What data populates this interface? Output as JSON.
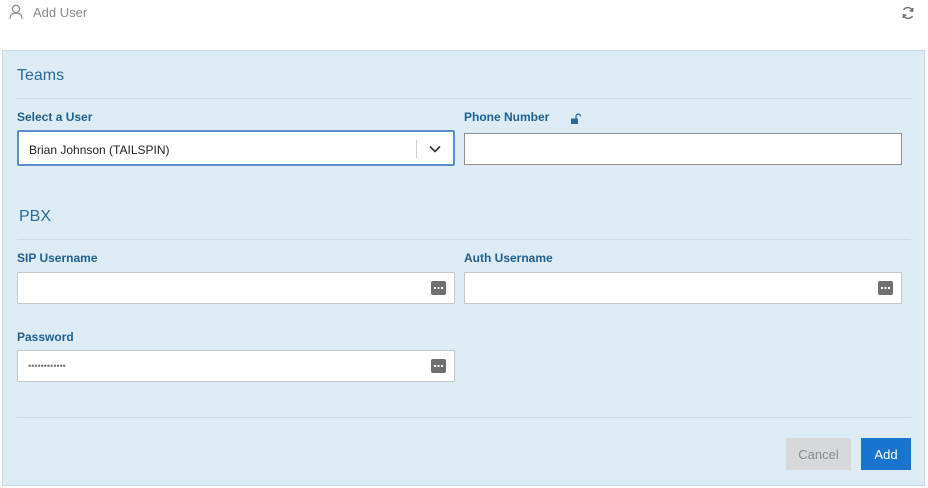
{
  "header": {
    "title": "Add User",
    "icon": "person-icon",
    "refresh_icon": "refresh-icon"
  },
  "teams": {
    "title": "Teams",
    "select_user_label": "Select a User",
    "select_user_value": "Brian Johnson (TAILSPIN)",
    "phone_label": "Phone Number",
    "phone_value": ""
  },
  "pbx": {
    "title": "PBX",
    "sip_label": "SIP Username",
    "sip_value": "",
    "auth_label": "Auth Username",
    "auth_value": "",
    "password_label": "Password",
    "password_value": "••••••••••••"
  },
  "actions": {
    "cancel_label": "Cancel",
    "add_label": "Add"
  },
  "colors": {
    "panel_bg": "#dcebf4",
    "accent": "#1874cd",
    "label": "#1f5f8e"
  }
}
